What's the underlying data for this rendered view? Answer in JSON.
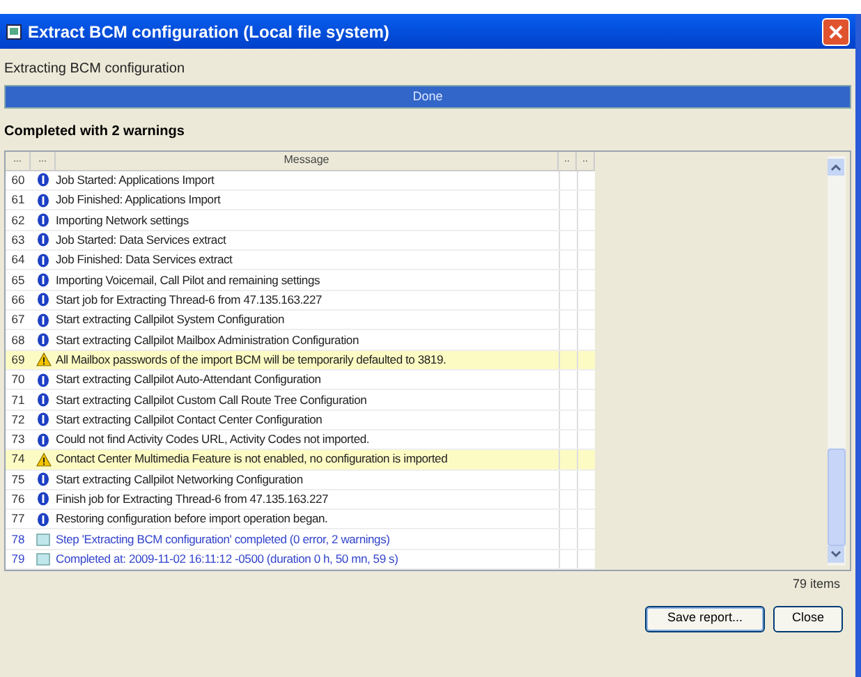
{
  "window": {
    "title": "Extract BCM configuration (Local file system)"
  },
  "task_label": "Extracting BCM configuration",
  "progress": {
    "level": 1,
    "text": "Done"
  },
  "result": "Completed with 2 warnings",
  "table": {
    "columns": [
      "...",
      "...",
      "Message",
      "..",
      ".."
    ],
    "rows": [
      {
        "num": "60",
        "kind": "info",
        "message": "Job Started: Applications Import"
      },
      {
        "num": "61",
        "kind": "info",
        "message": "Job Finished: Applications Import"
      },
      {
        "num": "62",
        "kind": "info",
        "message": "Importing Network settings"
      },
      {
        "num": "63",
        "kind": "info",
        "message": "Job Started: Data Services extract"
      },
      {
        "num": "64",
        "kind": "info",
        "message": "Job Finished: Data Services extract"
      },
      {
        "num": "65",
        "kind": "info",
        "message": "Importing Voicemail, Call Pilot and remaining settings"
      },
      {
        "num": "66",
        "kind": "info",
        "message": "Start job for Extracting Thread-6 from 47.135.163.227"
      },
      {
        "num": "67",
        "kind": "info",
        "message": "Start extracting Callpilot System Configuration"
      },
      {
        "num": "68",
        "kind": "info",
        "message": "Start extracting Callpilot Mailbox Administration Configuration"
      },
      {
        "num": "69",
        "kind": "warning",
        "message": "All Mailbox passwords of the import BCM will be temporarily defaulted to 3819."
      },
      {
        "num": "70",
        "kind": "info",
        "message": "Start extracting Callpilot Auto-Attendant Configuration"
      },
      {
        "num": "71",
        "kind": "info",
        "message": "Start extracting Callpilot Custom Call Route Tree Configuration"
      },
      {
        "num": "72",
        "kind": "info",
        "message": "Start extracting Callpilot Contact Center Configuration"
      },
      {
        "num": "73",
        "kind": "info",
        "message": "Could not find Activity Codes URL, Activity Codes not imported."
      },
      {
        "num": "74",
        "kind": "warning",
        "message": "Contact Center Multimedia Feature is not enabled, no configuration is imported"
      },
      {
        "num": "75",
        "kind": "info",
        "message": "Start extracting Callpilot Networking Configuration"
      },
      {
        "num": "76",
        "kind": "info",
        "message": "Finish job for Extracting Thread-6 from 47.135.163.227"
      },
      {
        "num": "77",
        "kind": "info",
        "message": "Restoring configuration before import operation began."
      },
      {
        "num": "78",
        "kind": "step",
        "message": "Step 'Extracting BCM configuration' completed (0 error, 2 warnings)"
      },
      {
        "num": "79",
        "kind": "step",
        "message": "Completed at: 2009-11-02 16:11:12 -0500 (duration 0 h, 50 mn, 59 s)"
      }
    ]
  },
  "item_count": "79 items",
  "buttons": [
    "Save report...",
    "Close"
  ]
}
